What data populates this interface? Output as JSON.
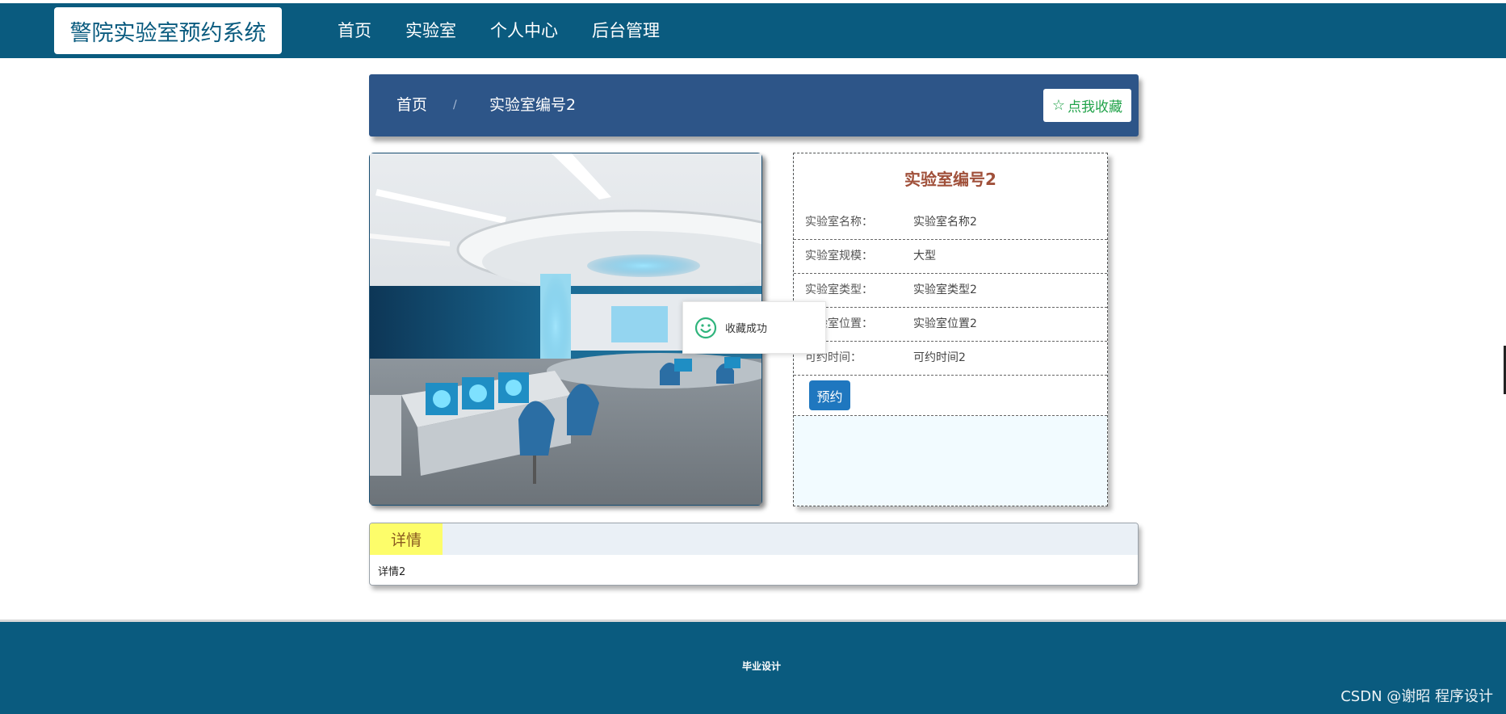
{
  "header": {
    "logo": "警院实验室预约系统",
    "nav": [
      "首页",
      "实验室",
      "个人中心",
      "后台管理"
    ]
  },
  "breadcrumb": {
    "home": "首页",
    "separator": "/",
    "current": "实验室编号2",
    "favorite_label": "点我收藏"
  },
  "lab": {
    "title": "实验室编号2",
    "fields": [
      {
        "label": "实验室名称：",
        "value": "实验室名称2"
      },
      {
        "label": "实验室规模：",
        "value": "大型"
      },
      {
        "label": "实验室类型：",
        "value": "实验室类型2"
      },
      {
        "label": "实验室位置：",
        "value": "实验室位置2"
      },
      {
        "label": "可约时间：",
        "value": "可约时间2"
      }
    ],
    "book_label": "预约"
  },
  "toast": {
    "message": "收藏成功"
  },
  "detail": {
    "tab": "详情",
    "content": "详情2"
  },
  "footer": {
    "text": "毕业设计"
  },
  "watermark": "CSDN @谢昭  程序设计",
  "colors": {
    "header_bg": "#0a5b7f",
    "breadcrumb_bg": "#2d5588",
    "favorite_text": "#21a34a",
    "title_color": "#a0503a",
    "book_button": "#1f77bf",
    "detail_tab": "#fdfd6a"
  }
}
